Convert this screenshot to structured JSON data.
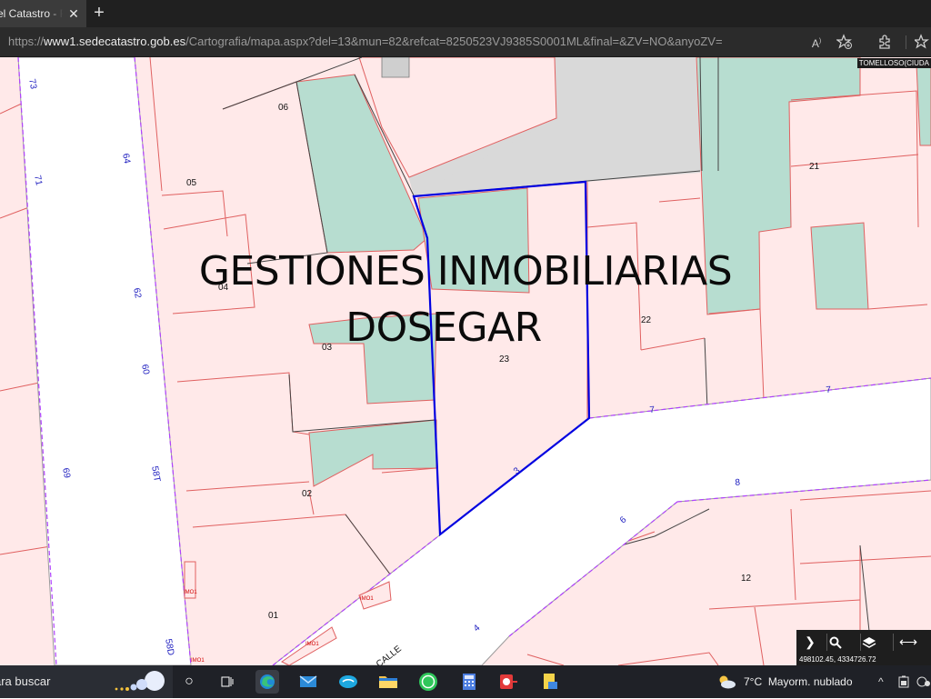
{
  "browser": {
    "tab_title": "el Catastro - Fo",
    "tab_close_icon": "close-icon",
    "new_tab_icon": "plus-icon",
    "url_prefix": "https://",
    "url_domain": "www1.sedecatastro.gob.es",
    "url_path": "/Cartografia/mapa.aspx?del=13&mun=82&refcat=8250523VJ9385S0001ML&final=&ZV=NO&anyoZV="
  },
  "map": {
    "watermark_line1": "GESTIONES INMOBILIARIAS",
    "watermark_line2": "DOSEGAR",
    "town_label": "TOMELLOSO(CIUDA",
    "coordinates": "498102.45, 4334726.72",
    "street_label": "CALLE",
    "parcel_labels": [
      "06",
      "05",
      "04",
      "03",
      "02",
      "01",
      "23",
      "22",
      "21",
      "12"
    ],
    "selected_parcel": "23",
    "street_numbers": [
      "73",
      "71",
      "64",
      "62",
      "60",
      "69",
      "58T",
      "58D",
      "7",
      "7",
      "3",
      "8",
      "6",
      "4"
    ],
    "tools": [
      "chevron-right-icon",
      "search-icon",
      "layers-icon",
      "measure-icon"
    ],
    "colors": {
      "parcel": "#ffe9e9",
      "built": "#b7ddd0",
      "road": "#ffffff",
      "grey_block": "#d9d9d9",
      "selection": "#0000e0",
      "parcel_line": "#e06060",
      "limit_line": "#b040ff"
    }
  },
  "taskbar": {
    "search_text": "ara buscar",
    "weather_temp": "7°C",
    "weather_text": "Mayorm. nublado",
    "apps": [
      "cortana-icon",
      "task-view-icon",
      "edge-icon",
      "mail-icon",
      "skype-icon",
      "file-explorer-icon",
      "whatsapp-icon",
      "calculator-icon",
      "app-red-icon",
      "notes-icon"
    ]
  }
}
